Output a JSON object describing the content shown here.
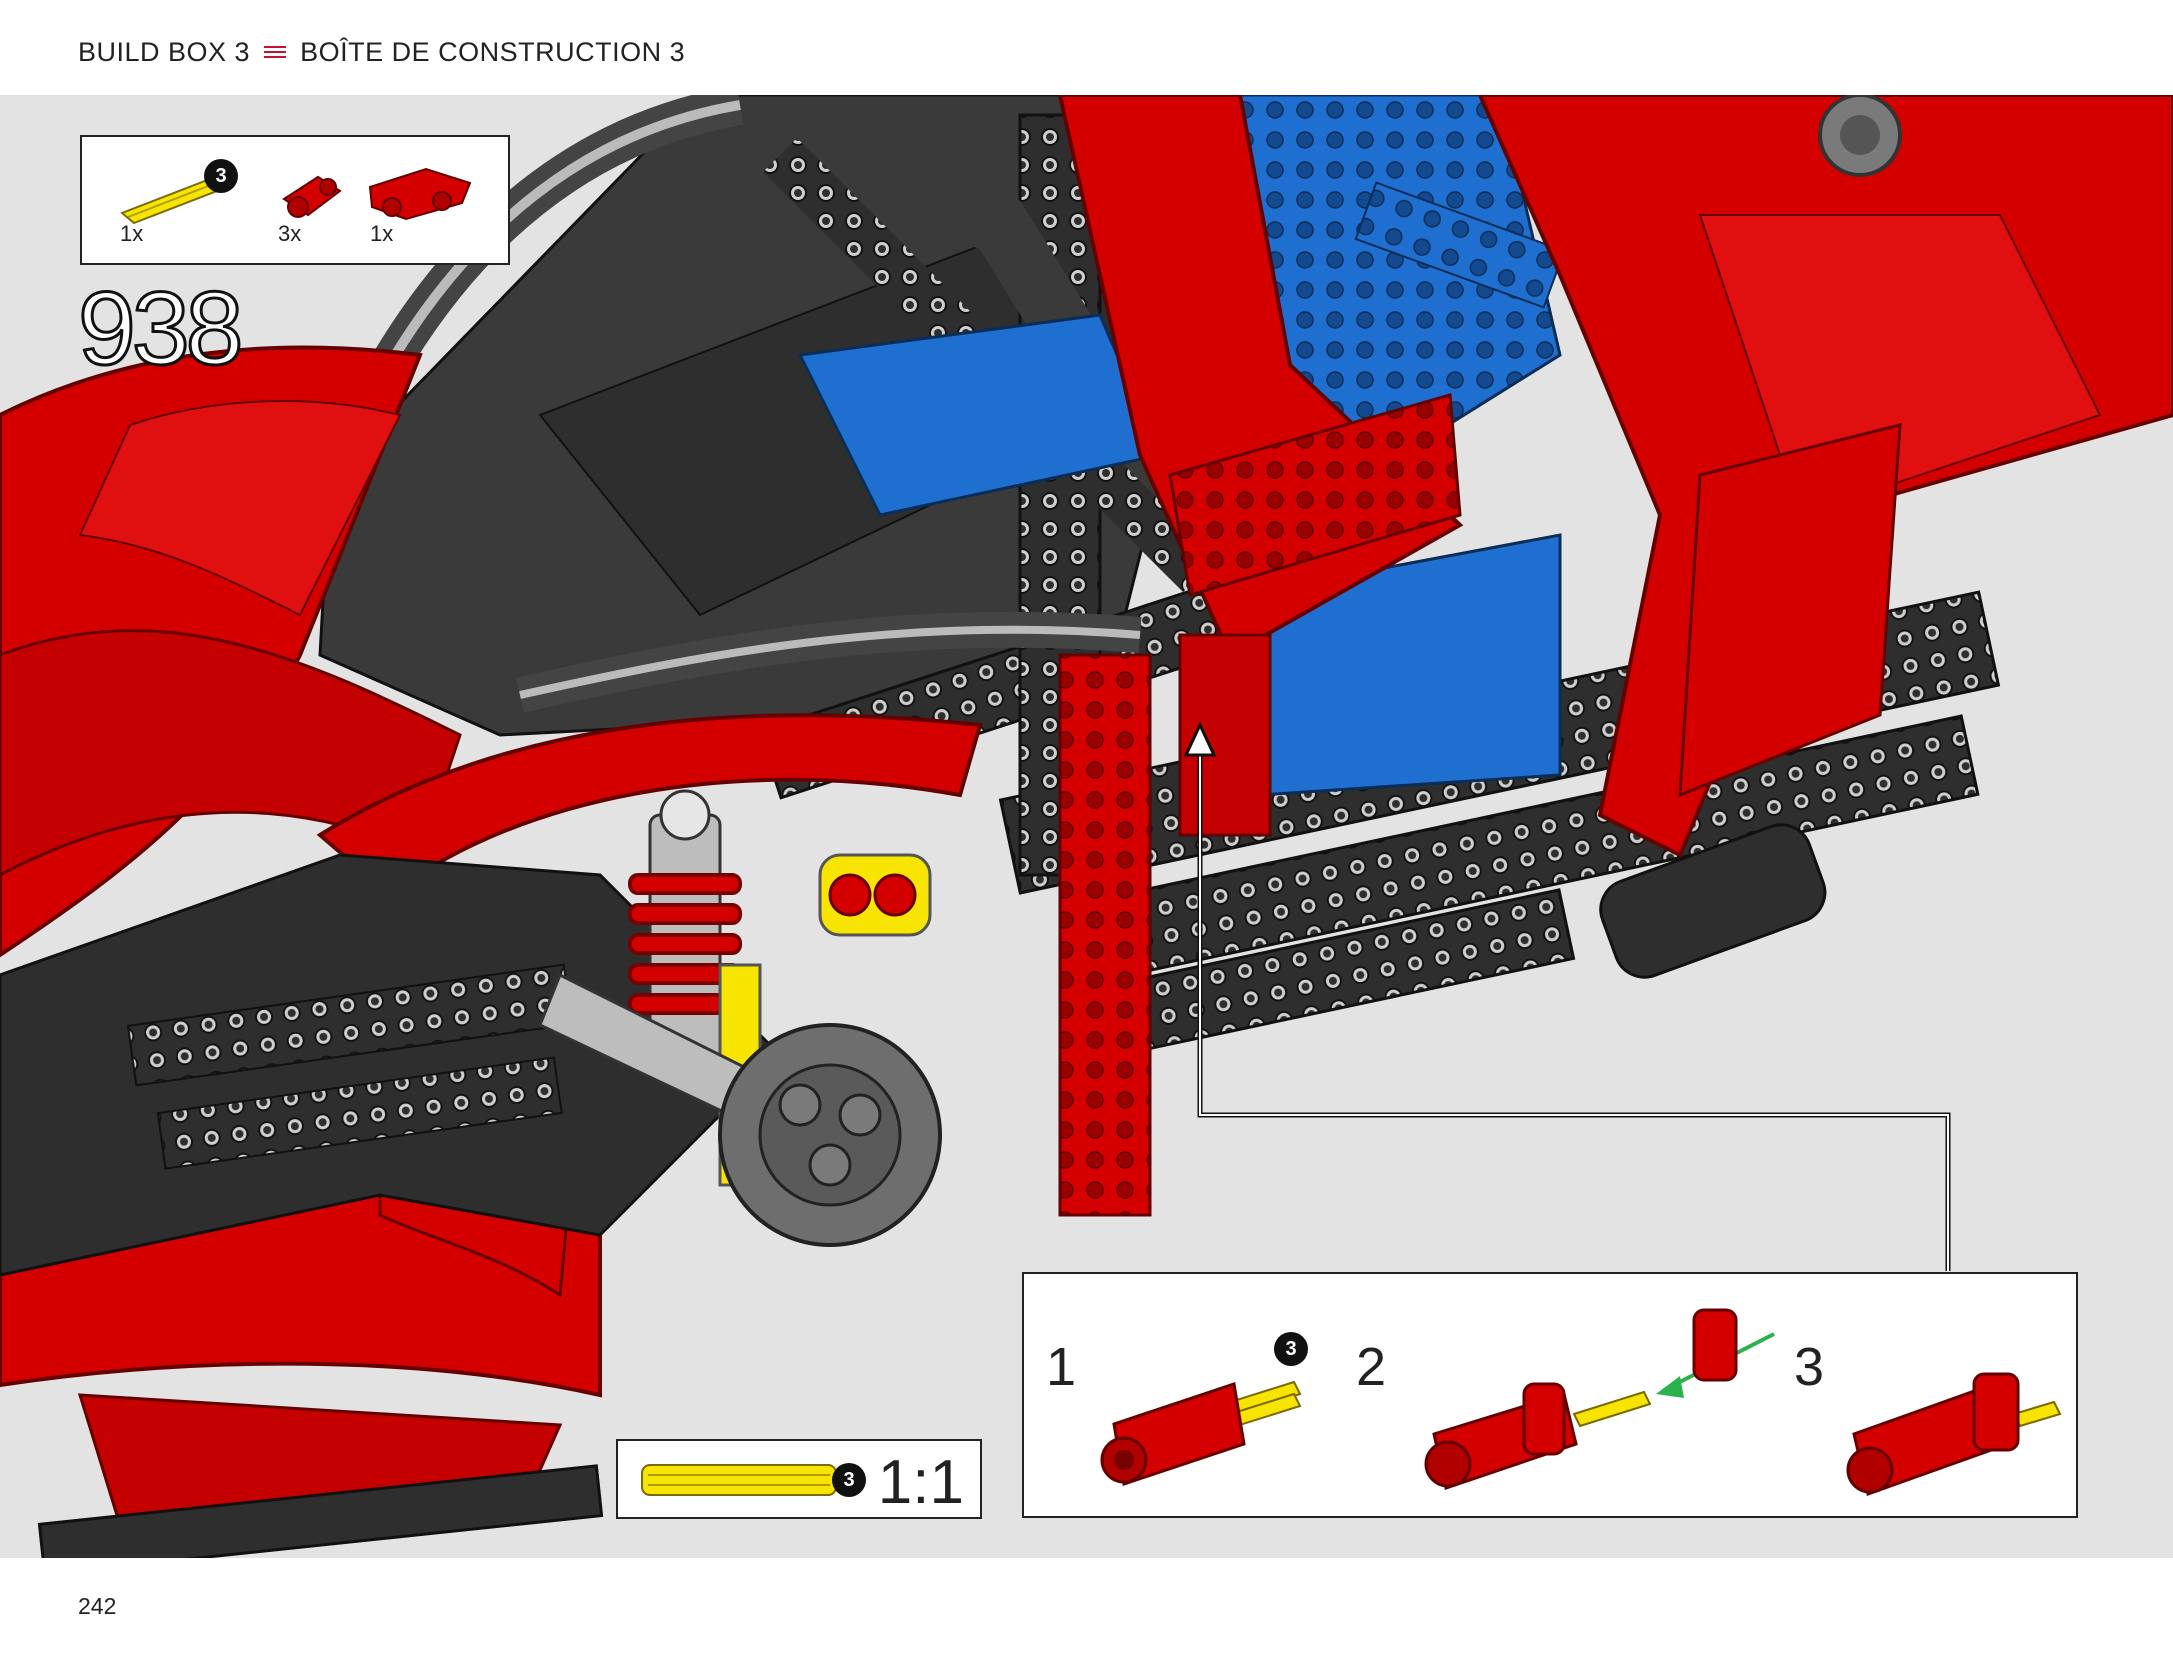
{
  "header": {
    "left": "BUILD BOX 3",
    "right": "BOÎTE DE CONSTRUCTION 3"
  },
  "parts_list": {
    "items": [
      {
        "name": "yellow axle 3",
        "count": "1x",
        "size_badge": "3",
        "color": "#f7e400"
      },
      {
        "name": "red connector",
        "count": "3x",
        "color": "#d40000"
      },
      {
        "name": "red panel connector",
        "count": "1x",
        "color": "#d40000"
      }
    ]
  },
  "step": {
    "number": "938"
  },
  "scale": {
    "badge": "3",
    "ratio": "1:1"
  },
  "callout": {
    "steps": [
      {
        "label": "1",
        "badge": "3"
      },
      {
        "label": "2"
      },
      {
        "label": "3"
      }
    ]
  },
  "page": {
    "number": "242"
  },
  "colors": {
    "lego_red": "#d40000",
    "lego_blue": "#1f6fd1",
    "lego_black": "#2e2e2e",
    "lego_yellow": "#f7e400",
    "lego_grey": "#a8a8a8",
    "background": "#e3e3e3",
    "accent_bars": "#c8102e",
    "arrow_green": "#2bb24c"
  }
}
